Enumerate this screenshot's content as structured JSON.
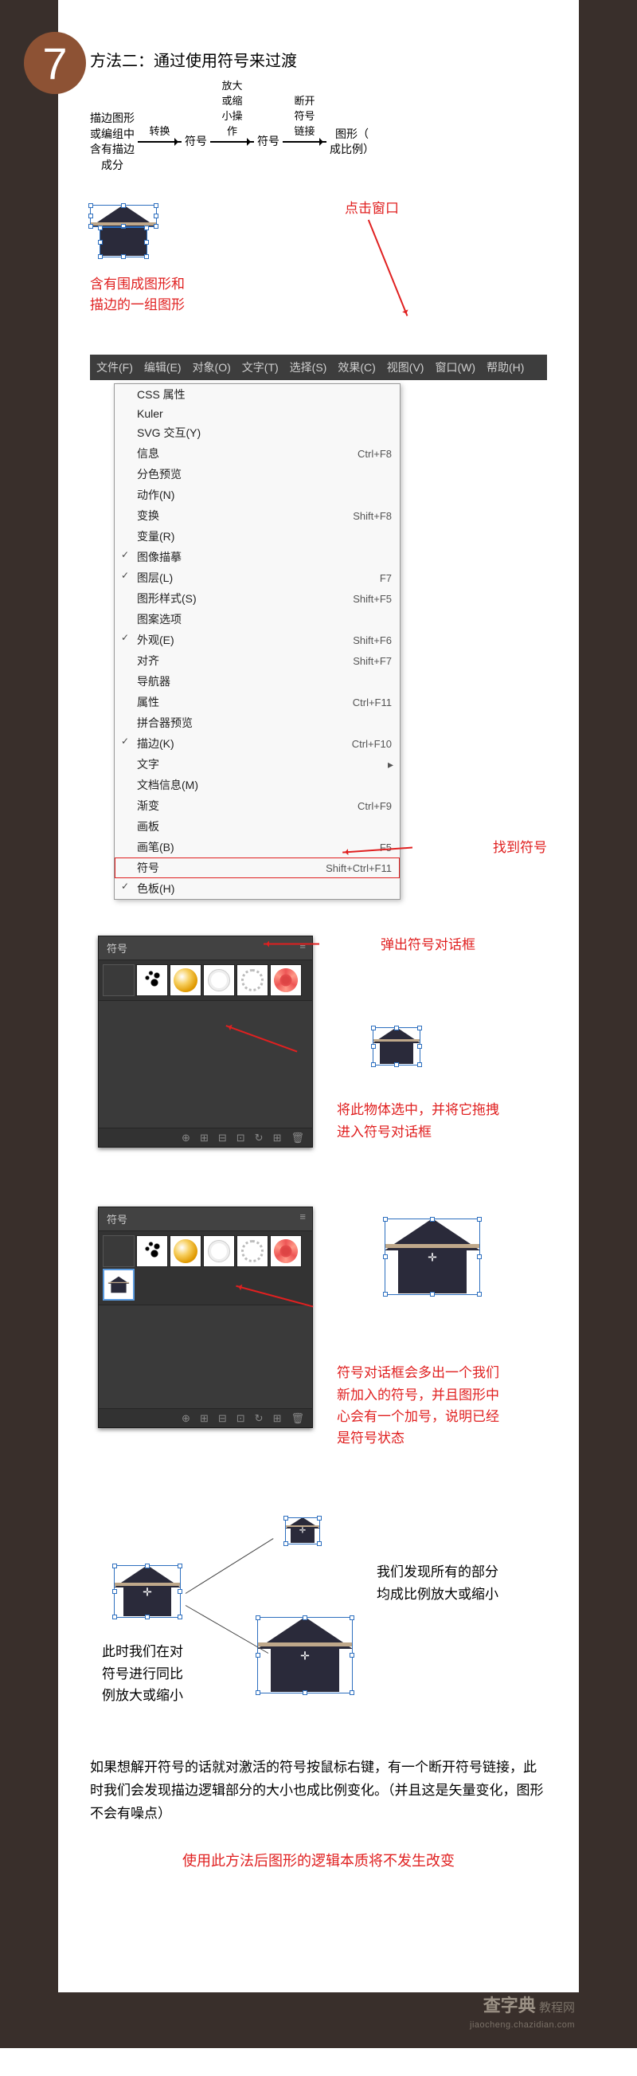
{
  "step_number": "7",
  "heading": "方法二：通过使用符号来过渡",
  "flow": {
    "box1": "描边图形\n或编组中\n含有描边\n成分",
    "arrow1": "转换",
    "box2": "符号",
    "arrow2": "放大或缩\n小操作",
    "box3": "符号",
    "arrow3": "断开符号\n链接",
    "box4": "图形（\n成比例）"
  },
  "caption_group": "含有围成图形和\n描边的一组图形",
  "click_window": "点击窗口",
  "menu_bar": [
    "文件(F)",
    "编辑(E)",
    "对象(O)",
    "文字(T)",
    "选择(S)",
    "效果(C)",
    "视图(V)",
    "窗口(W)",
    "帮助(H)"
  ],
  "dropdown_items": [
    {
      "label": "CSS 属性",
      "shortcut": "",
      "check": false,
      "sep": false,
      "sub": false
    },
    {
      "label": "Kuler",
      "shortcut": "",
      "check": false,
      "sep": false,
      "sub": false
    },
    {
      "label": "SVG 交互(Y)",
      "shortcut": "",
      "check": false,
      "sep": false,
      "sub": false
    },
    {
      "label": "信息",
      "shortcut": "Ctrl+F8",
      "check": false,
      "sep": false,
      "sub": false
    },
    {
      "label": "分色预览",
      "shortcut": "",
      "check": false,
      "sep": false,
      "sub": false
    },
    {
      "label": "动作(N)",
      "shortcut": "",
      "check": false,
      "sep": false,
      "sub": false
    },
    {
      "label": "变换",
      "shortcut": "Shift+F8",
      "check": false,
      "sep": false,
      "sub": false
    },
    {
      "label": "变量(R)",
      "shortcut": "",
      "check": false,
      "sep": false,
      "sub": false
    },
    {
      "label": "图像描摹",
      "shortcut": "",
      "check": true,
      "sep": false,
      "sub": false
    },
    {
      "label": "图层(L)",
      "shortcut": "F7",
      "check": true,
      "sep": false,
      "sub": false
    },
    {
      "label": "图形样式(S)",
      "shortcut": "Shift+F5",
      "check": false,
      "sep": false,
      "sub": false
    },
    {
      "label": "图案选项",
      "shortcut": "",
      "check": false,
      "sep": false,
      "sub": false
    },
    {
      "label": "外观(E)",
      "shortcut": "Shift+F6",
      "check": true,
      "sep": false,
      "sub": false
    },
    {
      "label": "对齐",
      "shortcut": "Shift+F7",
      "check": false,
      "sep": false,
      "sub": false
    },
    {
      "label": "导航器",
      "shortcut": "",
      "check": false,
      "sep": false,
      "sub": false
    },
    {
      "label": "属性",
      "shortcut": "Ctrl+F11",
      "check": false,
      "sep": false,
      "sub": false
    },
    {
      "label": "拼合器预览",
      "shortcut": "",
      "check": false,
      "sep": false,
      "sub": false
    },
    {
      "label": "描边(K)",
      "shortcut": "Ctrl+F10",
      "check": true,
      "sep": false,
      "sub": false
    },
    {
      "label": "文字",
      "shortcut": "",
      "check": false,
      "sep": false,
      "sub": true
    },
    {
      "label": "文档信息(M)",
      "shortcut": "",
      "check": false,
      "sep": false,
      "sub": false
    },
    {
      "label": "渐变",
      "shortcut": "Ctrl+F9",
      "check": false,
      "sep": false,
      "sub": false
    },
    {
      "label": "画板",
      "shortcut": "",
      "check": false,
      "sep": false,
      "sub": false
    },
    {
      "label": "画笔(B)",
      "shortcut": "F5",
      "check": false,
      "sep": false,
      "sub": false
    },
    {
      "label": "符号",
      "shortcut": "Shift+Ctrl+F11",
      "check": false,
      "sep": false,
      "sub": false,
      "highlight": true
    },
    {
      "label": "色板(H)",
      "shortcut": "",
      "check": true,
      "sep": false,
      "sub": false
    }
  ],
  "find_symbol": "找到符号",
  "popup_symbol": "弹出符号对话框",
  "symbol_panel_title": "符号",
  "drag_instruction": "将此物体选中，并将它拖拽\n进入符号对话框",
  "symbol_added": "符号对话框会多出一个我们\n新加入的符号，并且图形中\n心会有一个加号，说明已经\n是符号状态",
  "scale_observation": "我们发现所有的部分\n均成比例放大或缩小",
  "scale_action": "此时我们在对\n符号进行同比\n例放大或缩小",
  "break_link_para": "如果想解开符号的话就对激活的符号按鼠标右键，有一个断开符号链接，此时我们会发现描边逻辑部分的大小也成比例变化。（并且这是矢量变化，图形不会有噪点）",
  "final_note": "使用此方法后图形的逻辑本质将不发生改变",
  "watermark_big": "查字典",
  "watermark_small": "教程网",
  "watermark_url": "jiaocheng.chazidian.com"
}
